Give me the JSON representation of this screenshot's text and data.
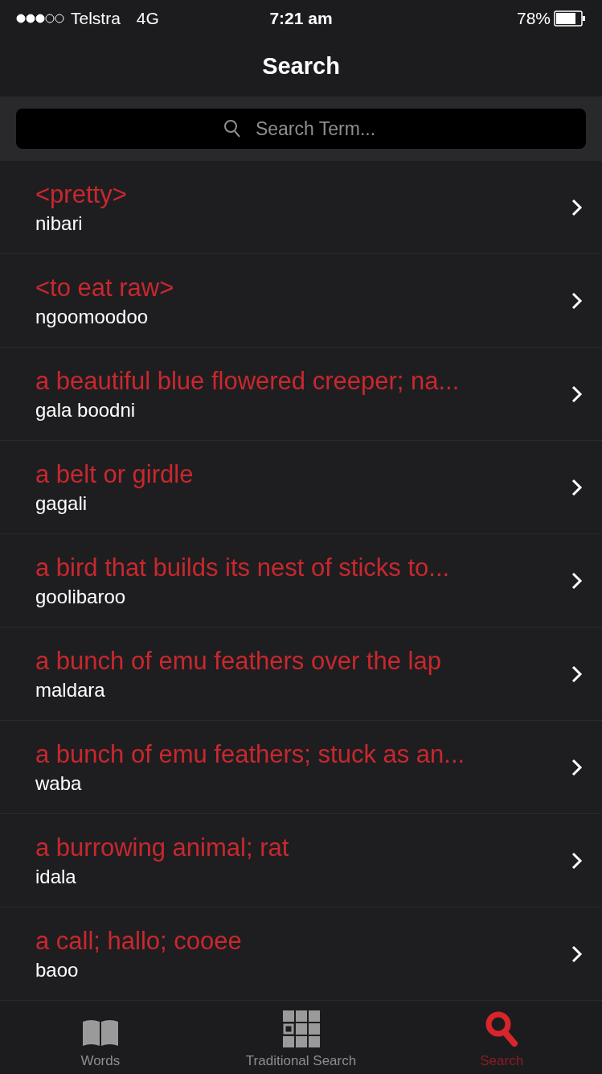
{
  "status_bar": {
    "carrier": "Telstra",
    "network": "4G",
    "time": "7:21 am",
    "battery": "78%"
  },
  "nav": {
    "title": "Search"
  },
  "search": {
    "placeholder": "Search Term..."
  },
  "results": [
    {
      "term": "<pretty>",
      "word": "nibari"
    },
    {
      "term": "<to eat raw>",
      "word": "ngoomoodoo"
    },
    {
      "term": "a beautiful blue flowered creeper; na...",
      "word": "gala boodni"
    },
    {
      "term": "a belt or girdle",
      "word": "gagali"
    },
    {
      "term": "a bird that builds its nest of sticks to...",
      "word": "goolibaroo"
    },
    {
      "term": "a bunch of emu feathers over the lap",
      "word": "maldara"
    },
    {
      "term": "a bunch of emu feathers; stuck as an...",
      "word": "waba"
    },
    {
      "term": "a burrowing animal; rat",
      "word": "idala"
    },
    {
      "term": "a call; hallo; cooee",
      "word": "baoo"
    }
  ],
  "tabs": [
    {
      "kind": "book",
      "label": "Words",
      "selected": false
    },
    {
      "kind": "grid",
      "label": "Traditional Search",
      "selected": false
    },
    {
      "kind": "search",
      "label": "Search",
      "selected": true
    }
  ]
}
